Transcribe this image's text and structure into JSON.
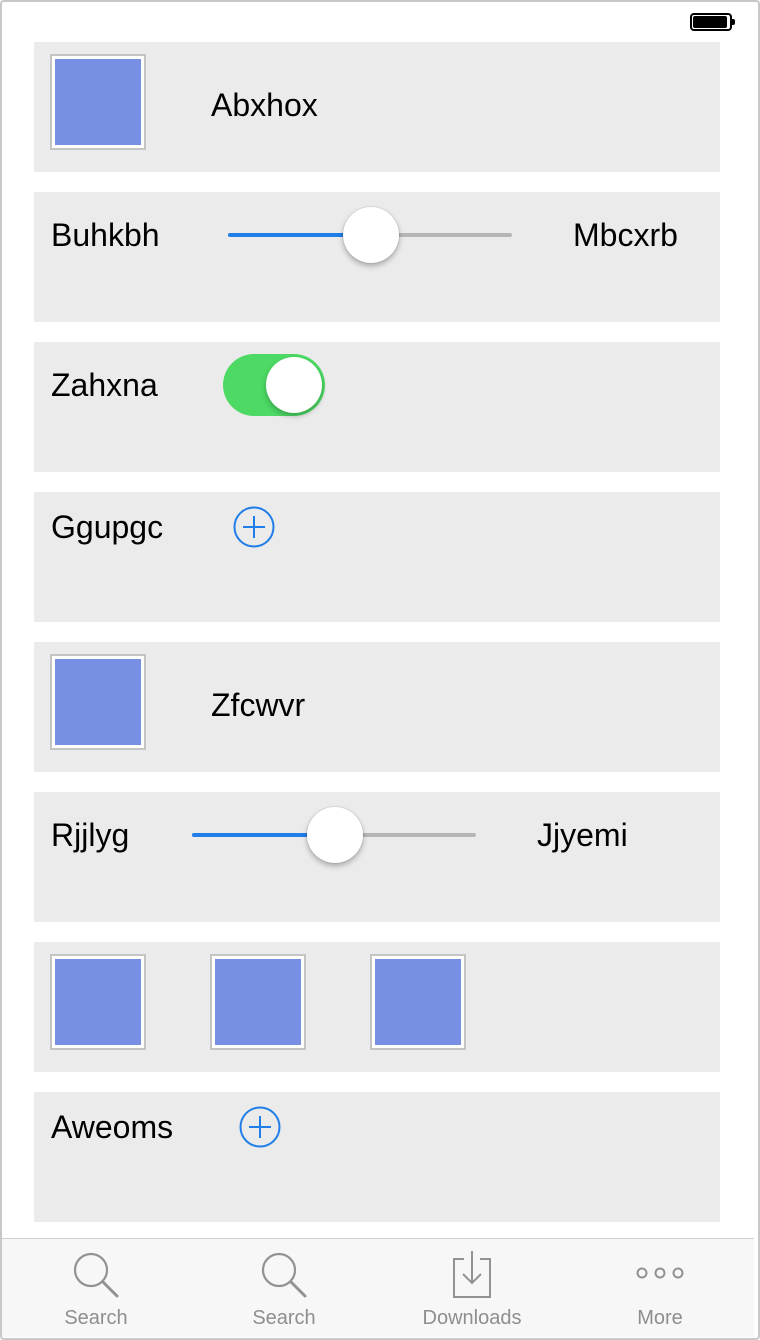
{
  "status_bar": {
    "battery_icon": "battery-full-icon"
  },
  "rows": {
    "row1": {
      "label": "Abxhox",
      "image_color": "#7890e4"
    },
    "row2": {
      "left_label": "Buhkbh",
      "right_label": "Mbcxrb",
      "slider_value": 0.41
    },
    "row3": {
      "label": "Zahxna",
      "toggle_on": true,
      "toggle_color": "#4cd964"
    },
    "row4": {
      "label": "Ggupgc",
      "add_icon": "plus-circle-icon"
    },
    "row5": {
      "label": "Zfcwvr",
      "image_color": "#7890e4"
    },
    "row6": {
      "left_label": "Rjjlyg",
      "right_label": "Jjyemi",
      "slider_value": 0.5
    },
    "row7": {
      "image_count": 3,
      "image_color": "#7890e4"
    },
    "row8": {
      "label": "Aweoms",
      "add_icon": "plus-circle-icon"
    }
  },
  "tabbar": {
    "tabs": [
      {
        "label": "Search",
        "icon": "search-icon"
      },
      {
        "label": "Search",
        "icon": "search-icon"
      },
      {
        "label": "Downloads",
        "icon": "download-icon"
      },
      {
        "label": "More",
        "icon": "more-icon"
      }
    ]
  },
  "colors": {
    "accent": "#1f7ee8",
    "row_background": "#ebebeb",
    "image_fill": "#7890e4",
    "toggle_on": "#4cd964"
  }
}
